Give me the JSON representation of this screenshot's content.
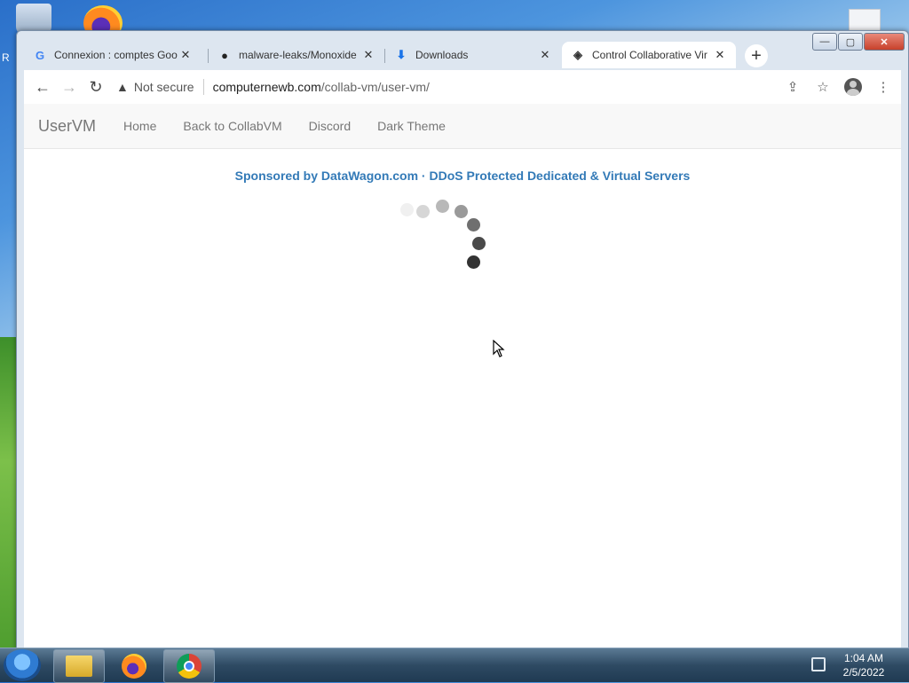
{
  "desktop": {
    "side_letter": "R"
  },
  "window": {
    "minimize": "—",
    "maximize": "▢",
    "close": "✕"
  },
  "tabs": [
    {
      "favicon": "google-icon",
      "favicon_glyph": "G",
      "title": "Connexion : comptes Goo",
      "close": "✕",
      "active": false
    },
    {
      "favicon": "github-icon",
      "favicon_glyph": "●",
      "title": "malware-leaks/Monoxide",
      "close": "✕",
      "active": false
    },
    {
      "favicon": "download-icon",
      "favicon_glyph": "⬇",
      "title": "Downloads",
      "close": "✕",
      "active": false
    },
    {
      "favicon": "collabvm-icon",
      "favicon_glyph": "◈",
      "title": "Control Collaborative Vir",
      "close": "✕",
      "active": true
    }
  ],
  "new_tab": "+",
  "toolbar": {
    "back": "←",
    "forward": "→",
    "reload": "↻",
    "security_icon": "▲",
    "security_text": "Not secure",
    "url_host": "computernewb.com",
    "url_path": "/collab-vm/user-vm/",
    "share": "⇪",
    "bookmark": "☆",
    "menu": "⋮"
  },
  "page": {
    "brand": "UserVM",
    "nav": [
      "Home",
      "Back to CollabVM",
      "Discord",
      "Dark Theme"
    ],
    "sponsor": "Sponsored by DataWagon.com · DDoS Protected Dedicated & Virtual Servers"
  },
  "taskbar": {
    "apps": [
      "explorer-icon",
      "firefox-icon",
      "chrome-icon"
    ],
    "time": "1:04 AM",
    "date": "2/5/2022"
  },
  "colors": {
    "link": "#337ab7",
    "tab_bg": "#dde6f0",
    "taskbar": "#2e4a63"
  }
}
